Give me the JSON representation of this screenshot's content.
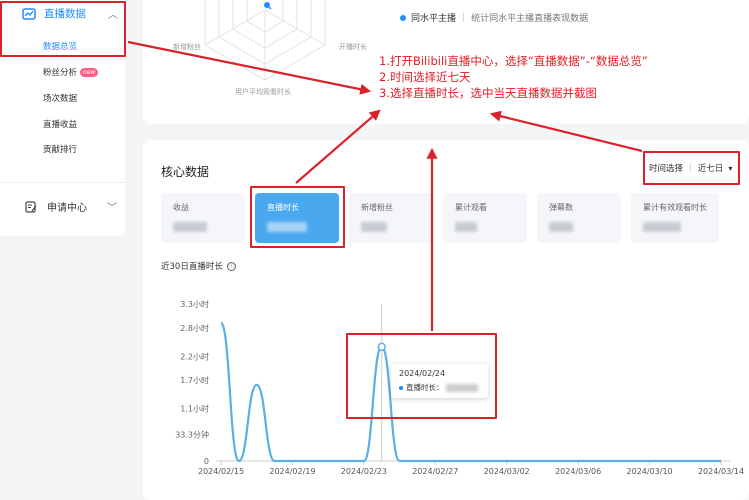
{
  "sidebar": {
    "section_label": "直播数据",
    "items": [
      {
        "label": "数据总览",
        "active": true
      },
      {
        "label": "粉丝分析",
        "badge": "new"
      },
      {
        "label": "场次数据"
      },
      {
        "label": "直播收益"
      },
      {
        "label": "贡献排行"
      }
    ],
    "apply_center": "申请中心"
  },
  "radar": {
    "labels": [
      "新增粉丝",
      "开播时长",
      "用户平均观看时长"
    ]
  },
  "top_legend": {
    "name": "同水平主播",
    "description": "统计同水平主播直播表现数据"
  },
  "core": {
    "title": "核心数据",
    "time_select_label": "时间选择",
    "time_select_value": "近七日",
    "metrics": [
      {
        "label": "收益"
      },
      {
        "label": "直播时长",
        "active": true
      },
      {
        "label": "新增粉丝"
      },
      {
        "label": "累计观看"
      },
      {
        "label": "弹幕数"
      },
      {
        "label": "累计有效观看时长"
      }
    ],
    "chart_subtitle": "近30日直播时长",
    "info_icon": "ⓘ"
  },
  "tooltip": {
    "date": "2024/02/24",
    "series_label": "直播时长："
  },
  "instructions": [
    "1.打开Bilibili直播中心，选择“直播数据”-“数据总览”",
    "2.时间选择近七天",
    "3.选择直播时长，选中当天直播数据并截图"
  ],
  "colors": {
    "accent": "#1f8cff",
    "annotation_red": "#d9232a",
    "active_metric": "#49a8ee",
    "line": "#5aafe6"
  },
  "chart_data": {
    "type": "line",
    "ylabel": "",
    "yticks": [
      "0",
      "33.3分钟",
      "1.1小时",
      "1.7小时",
      "2.2小时",
      "2.8小时",
      "3.3小时"
    ],
    "ytick_values": [
      0,
      0.555,
      1.1,
      1.7,
      2.2,
      2.8,
      3.3
    ],
    "ylim": [
      0,
      3.3
    ],
    "xticks": [
      "2024/02/15",
      "2024/02/19",
      "2024/02/23",
      "2024/02/27",
      "2024/03/02",
      "2024/03/06",
      "2024/03/10",
      "2024/03/14"
    ],
    "x": [
      "2024/02/15",
      "2024/02/16",
      "2024/02/17",
      "2024/02/18",
      "2024/02/19",
      "2024/02/20",
      "2024/02/21",
      "2024/02/22",
      "2024/02/23",
      "2024/02/24",
      "2024/02/25",
      "2024/02/26",
      "2024/02/27",
      "2024/02/28",
      "2024/02/29",
      "2024/03/01",
      "2024/03/02",
      "2024/03/03",
      "2024/03/04",
      "2024/03/05",
      "2024/03/06",
      "2024/03/07",
      "2024/03/08",
      "2024/03/09",
      "2024/03/10",
      "2024/03/11",
      "2024/03/12",
      "2024/03/13",
      "2024/03/14"
    ],
    "series": [
      {
        "values": [
          2.9,
          0,
          1.6,
          0,
          0,
          0,
          0,
          0,
          0,
          2.4,
          0,
          0,
          0,
          0,
          0,
          0,
          0,
          0,
          0,
          0,
          0,
          0,
          0,
          0,
          0,
          0,
          0,
          0,
          0
        ]
      }
    ],
    "highlight": "2024/02/24",
    "grid": false
  }
}
